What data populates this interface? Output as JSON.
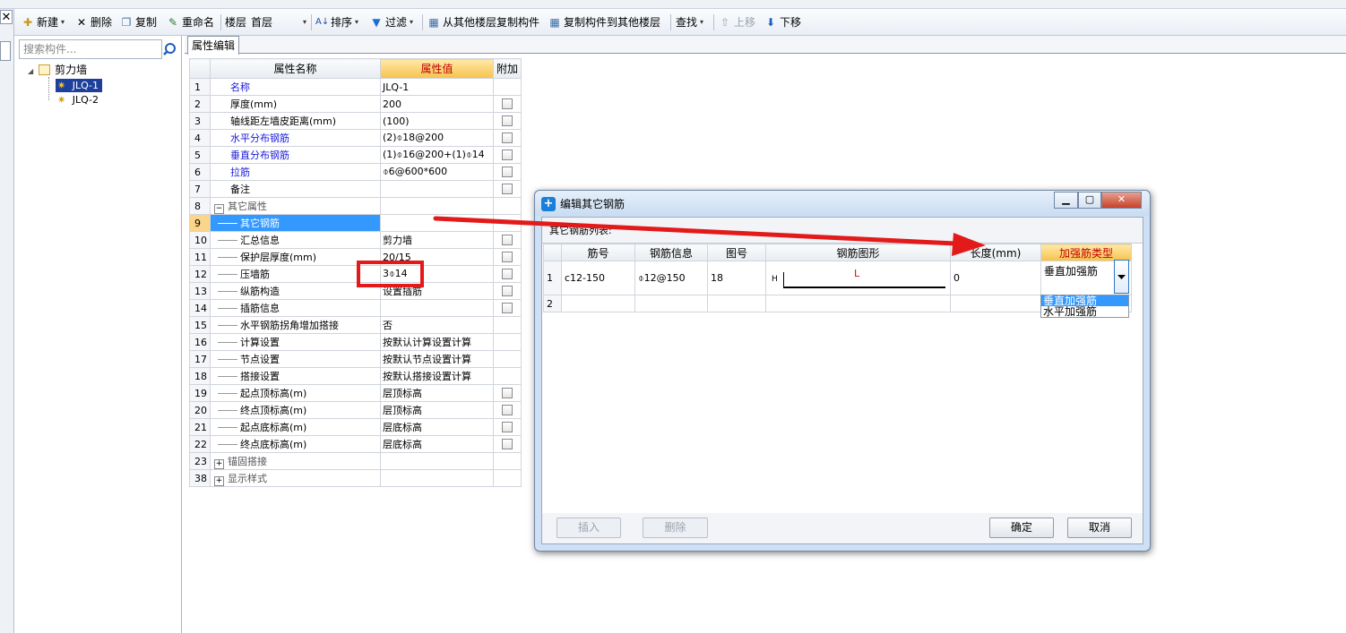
{
  "toolbar": {
    "new_label": "新建",
    "delete_label": "删除",
    "copy_label": "复制",
    "rename_label": "重命名",
    "floor_label": "楼层",
    "floor_value": "首层",
    "sort_label": "排序",
    "filter_label": "过滤",
    "copy_from_floor_label": "从其他楼层复制构件",
    "copy_to_floor_label": "复制构件到其他楼层",
    "find_label": "查找",
    "move_up_label": "上移",
    "move_down_label": "下移"
  },
  "left_panel": {
    "search_placeholder": "搜索构件...",
    "tree": {
      "root_label": "剪力墙",
      "children": [
        "JLQ-1",
        "JLQ-2"
      ],
      "selected": "JLQ-1"
    }
  },
  "property_panel": {
    "tab_label": "属性编辑",
    "headers": {
      "name": "属性名称",
      "value": "属性值",
      "extra": "附加"
    },
    "rows": [
      {
        "num": "1",
        "name": "名称",
        "value": "JLQ-1"
      },
      {
        "num": "2",
        "name": "厚度(mm)",
        "value": "200"
      },
      {
        "num": "3",
        "name": "轴线距左墙皮距离(mm)",
        "value": "(100)"
      },
      {
        "num": "4",
        "name": "水平分布钢筋",
        "value": "(2)⌽18@200"
      },
      {
        "num": "5",
        "name": "垂直分布钢筋",
        "value": "(1)⌽16@200+(1)⌽14"
      },
      {
        "num": "6",
        "name": "拉筋",
        "value": "⌽6@600*600"
      },
      {
        "num": "7",
        "name": "备注",
        "value": ""
      },
      {
        "num": "8",
        "name": "其它属性",
        "value": ""
      },
      {
        "num": "9",
        "name": "其它钢筋",
        "value": ""
      },
      {
        "num": "10",
        "name": "汇总信息",
        "value": "剪力墙"
      },
      {
        "num": "11",
        "name": "保护层厚度(mm)",
        "value": "20/15"
      },
      {
        "num": "12",
        "name": "压墙筋",
        "value": "3⌽14"
      },
      {
        "num": "13",
        "name": "纵筋构造",
        "value": "设置插筋"
      },
      {
        "num": "14",
        "name": "插筋信息",
        "value": ""
      },
      {
        "num": "15",
        "name": "水平钢筋拐角增加搭接",
        "value": "否"
      },
      {
        "num": "16",
        "name": "计算设置",
        "value": "按默认计算设置计算"
      },
      {
        "num": "17",
        "name": "节点设置",
        "value": "按默认节点设置计算"
      },
      {
        "num": "18",
        "name": "搭接设置",
        "value": "按默认搭接设置计算"
      },
      {
        "num": "19",
        "name": "起点顶标高(m)",
        "value": "层顶标高"
      },
      {
        "num": "20",
        "name": "终点顶标高(m)",
        "value": "层顶标高"
      },
      {
        "num": "21",
        "name": "起点底标高(m)",
        "value": "层底标高"
      },
      {
        "num": "22",
        "name": "终点底标高(m)",
        "value": "层底标高"
      },
      {
        "num": "23",
        "name": "锚固搭接",
        "value": ""
      },
      {
        "num": "38",
        "name": "显示样式",
        "value": ""
      }
    ]
  },
  "dialog": {
    "title": "编辑其它钢筋",
    "list_label": "其它钢筋列表:",
    "headers": {
      "bar_no": "筋号",
      "bar_info": "钢筋信息",
      "shape_no": "图号",
      "shape": "钢筋图形",
      "length": "长度(mm)",
      "type": "加强筋类型"
    },
    "rows": [
      {
        "num": "1",
        "bar_no": "c12-150",
        "bar_info": "⌽12@150",
        "shape_no": "18",
        "shape_h": "H",
        "shape_l": "L",
        "length": "0",
        "type": "垂直加强筋"
      },
      {
        "num": "2",
        "bar_no": "",
        "bar_info": "",
        "shape_no": "",
        "shape_h": "",
        "shape_l": "",
        "length": "",
        "type": ""
      }
    ],
    "dropdown_options": [
      "垂直加强筋",
      "水平加强筋"
    ],
    "dropdown_highlighted": "垂直加强筋",
    "insert_label": "插入",
    "delete_label": "删除",
    "ok_label": "确定",
    "cancel_label": "取消"
  },
  "colors": {
    "accent_header": "#f7c24c",
    "selection_blue": "#3399ff",
    "annotation_red": "#e31a1a",
    "link_blue": "#1a1adc"
  }
}
